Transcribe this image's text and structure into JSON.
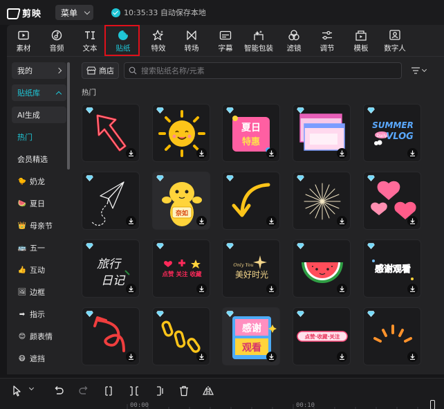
{
  "app": {
    "name": "剪映",
    "menu_label": "菜单",
    "autosave_text": "10:35:33 自动保存本地"
  },
  "toolbar": {
    "tools": [
      {
        "label": "素材",
        "icon": "media-icon"
      },
      {
        "label": "音频",
        "icon": "audio-icon"
      },
      {
        "label": "文本",
        "icon": "text-icon"
      },
      {
        "label": "贴纸",
        "icon": "sticker-icon",
        "active": true
      },
      {
        "label": "特效",
        "icon": "effects-icon"
      },
      {
        "label": "转场",
        "icon": "transition-icon"
      },
      {
        "label": "字幕",
        "icon": "subtitle-icon"
      },
      {
        "label": "智能包装",
        "icon": "smart-package-icon"
      },
      {
        "label": "滤镜",
        "icon": "filter-icon"
      },
      {
        "label": "调节",
        "icon": "adjust-icon"
      },
      {
        "label": "模板",
        "icon": "template-icon"
      },
      {
        "label": "数字人",
        "icon": "digital-human-icon"
      }
    ]
  },
  "sidebar": {
    "mine_label": "我的",
    "library_label": "贴纸库",
    "items": [
      {
        "label": "AI生成",
        "style": "box"
      },
      {
        "label": "热门",
        "style": "cyan"
      },
      {
        "label": "会员精选"
      },
      {
        "label": "奶龙",
        "emoji": "🐤"
      },
      {
        "label": "夏日",
        "emoji": "🍉"
      },
      {
        "label": "母亲节",
        "emoji": "👑"
      },
      {
        "label": "五一",
        "emoji": "🚌"
      },
      {
        "label": "互动",
        "emoji": "👍"
      },
      {
        "label": "边框",
        "emoji": "🖼"
      },
      {
        "label": "指示",
        "emoji": "➡"
      },
      {
        "label": "颜表情",
        "emoji": "😊"
      },
      {
        "label": "遮挡",
        "emoji": "😷"
      }
    ]
  },
  "content": {
    "store_label": "商店",
    "search_placeholder": "搜索贴纸名称/元素",
    "section_title": "热门",
    "sticker_texts": {
      "summer_1": "SUMMER",
      "summer_2": "Daily",
      "summer_3": "VLOG",
      "travel_1": "旅行",
      "travel_2": "日记",
      "like_follow": "点赞 关注 收藏",
      "only_you": "Only You",
      "beautiful_time": "美好时光",
      "thanks": "感谢观看",
      "thanks_a": "感谢",
      "thanks_b": "观看",
      "like_bar": "点赞·收藏·关注",
      "summer_day_1": "夏日",
      "summer_day_2": "特惠",
      "naiLong_tag": "奈如"
    }
  },
  "timeline": {
    "tick_0": "00:00",
    "tick_1": "00:10"
  },
  "colors": {
    "accent": "#1fc6d6",
    "highlight": "#e0101a",
    "panel": "#232325"
  }
}
